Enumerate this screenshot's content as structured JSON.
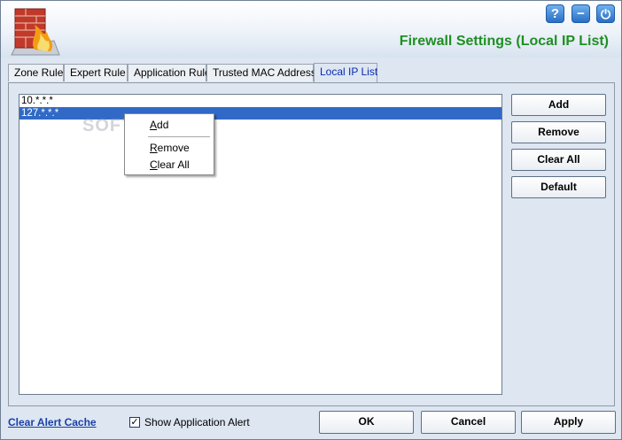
{
  "header": {
    "title": "Firewall Settings (Local IP List)",
    "help_glyph": "?",
    "minimize_glyph": "−",
    "power_glyph": "⏻"
  },
  "tabs": [
    {
      "label": "Zone Rule",
      "active": false
    },
    {
      "label": "Expert Rule",
      "active": false
    },
    {
      "label": "Application Rule",
      "active": false
    },
    {
      "label": "Trusted MAC Address",
      "active": false
    },
    {
      "label": "Local IP List",
      "active": true
    }
  ],
  "ip_list": {
    "items": [
      "10.*.*.*",
      "127.*.*.*"
    ],
    "selected_index": 1
  },
  "side_buttons": {
    "add": "Add",
    "remove": "Remove",
    "clear_all": "Clear All",
    "default": "Default"
  },
  "context_menu": {
    "add": "Add",
    "remove": "Remove",
    "clear_all": "Clear All"
  },
  "watermark": "SOFTPEDIA",
  "footer": {
    "clear_cache_link": "Clear Alert Cache",
    "show_alert_label": "Show Application Alert",
    "show_alert_checked": true,
    "ok": "OK",
    "cancel": "Cancel",
    "apply": "Apply"
  },
  "colors": {
    "title": "#1f8f24",
    "selection": "#3169c6",
    "link": "#1b3fa8"
  }
}
